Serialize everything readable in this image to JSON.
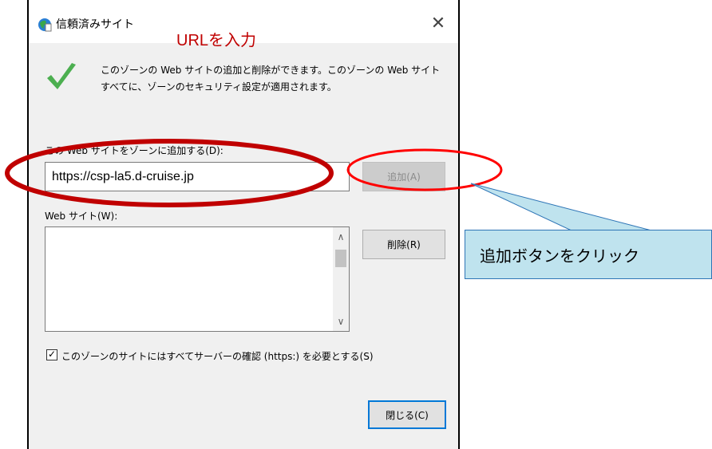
{
  "dialog": {
    "title": "信頼済みサイト",
    "close_symbol": "✕",
    "description": "このゾーンの Web サイトの追加と削除ができます。このゾーンの Web サイトすべてに、ゾーンのセキュリティ設定が適用されます。",
    "add_label": "この Web サイトをゾーンに追加する(D):",
    "url_value": "https://csp-la5.d-cruise.jp",
    "add_button": "追加(A)",
    "websites_label": "Web サイト(W):",
    "websites": [],
    "remove_button": "削除(R)",
    "scroll_up": "∧",
    "scroll_down": "∨",
    "https_check_mark": "✓",
    "https_checked": true,
    "https_label": "このゾーンのサイトにはすべてサーバーの確認 (https:) を必要とする(S)",
    "close_button": "閉じる(C)"
  },
  "annotations": {
    "title": "URLを入力",
    "callout": "追加ボタンをクリック",
    "ellipse_color": "#c00000",
    "callout_fill": "#bfe3ee",
    "callout_border": "#2e75b6"
  },
  "icons": [
    "globe-icon",
    "checkmark-icon",
    "close-icon",
    "chevron-up-icon",
    "chevron-down-icon",
    "checkbox-icon"
  ]
}
